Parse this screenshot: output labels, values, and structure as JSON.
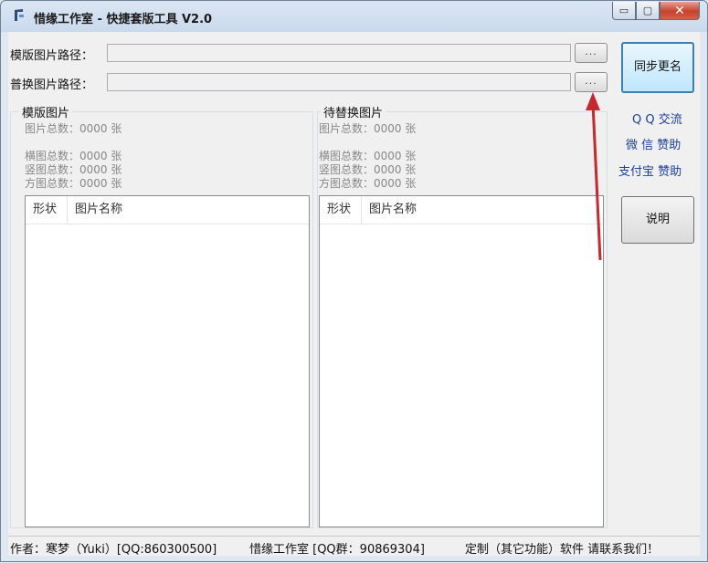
{
  "window": {
    "title": "惜缘工作室 - 快捷套版工具 V2.0",
    "minimize_glyph": "▭",
    "maximize_glyph": "▢",
    "close_glyph": "✕"
  },
  "paths": {
    "template_label": "模版图片路径：",
    "template_value": "",
    "replace_label": "普换图片路径：",
    "replace_value": "",
    "browse_label": "..."
  },
  "sidebar": {
    "rename_button": "同步更名",
    "qq_link": "Q Q 交流",
    "wechat_link": "微 信 赞助",
    "alipay_link": "支付宝 赞助",
    "help_button": "说明"
  },
  "template_panel": {
    "title": "模版图片",
    "total": "图片总数：0000 张",
    "horizontal": "横图总数：0000 张",
    "vertical": "竖图总数：0000 张",
    "square": "方图总数：0000 张",
    "columns": [
      "形状",
      "图片名称"
    ]
  },
  "replace_panel": {
    "title": "待替换图片",
    "total": "图片总数：0000 张",
    "horizontal": "横图总数：0000 张",
    "vertical": "竖图总数：0000 张",
    "square": "方图总数：0000 张",
    "columns": [
      "形状",
      "图片名称"
    ]
  },
  "status": {
    "author": "作者：寒梦（Yuki）[QQ:860300500]",
    "studio": "惜缘工作室 [QQ群：90869304]",
    "custom": "定制（其它功能）软件 请联系我们！"
  },
  "colors": {
    "annotation_arrow": "#c8272d",
    "link": "#1c3f9a"
  }
}
